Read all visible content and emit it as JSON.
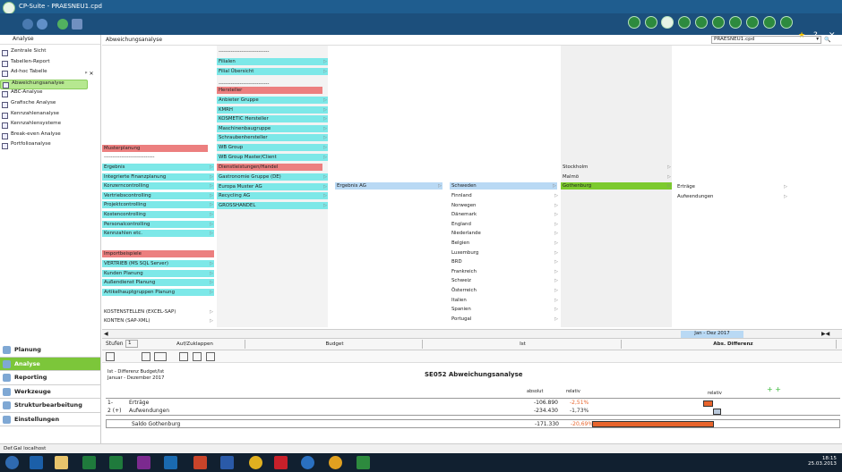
{
  "title": "CP-Suite - PRAESNEU1.cpd",
  "side": {
    "header": "Analyse",
    "items": [
      "Zentrale Sicht",
      "Tabellen-Report",
      "Ad-hoc Tabelle",
      "Abweichungsanalyse",
      "ABC-Analyse",
      "Grafische Analyse",
      "Kennzahlenanalyse",
      "Kennzahlensysteme",
      "Break-even Analyse",
      "Portfolioanalyse"
    ],
    "selected": 3
  },
  "main": {
    "header": "Abweichungsanalyse",
    "file": "PRAESNEU1.cpd"
  },
  "col1": {
    "group1_title": "Musterplanung",
    "group1_sep": "-----------------------------",
    "group1": [
      "Ergebnis",
      "Integrierte Finanzplanung",
      "Konzerncontrolling",
      "Vertriebscontrolling",
      "Projektcontrolling",
      "Kostencontrolling",
      "Personalcontrolling",
      "Kennzahlen etc."
    ],
    "group2_title": "Importbeispiele",
    "group2": [
      "VERTRIEB (MS SQL Server)",
      "Kunden Planung",
      "Außendienst Planung",
      "Artikelhauptgruppen Planung"
    ],
    "extra": [
      "KOSTENSTELLEN (EXCEL-SAP)",
      "KONTEN (SAP-XML)"
    ]
  },
  "col2": {
    "sep1": "-----------------------------",
    "top": [
      "Filialen",
      "Filial Übersicht"
    ],
    "sep2": "-----------------------------",
    "h_title": "Hersteller",
    "h_items": [
      "Anbieter Gruppe",
      "KMRH",
      "KOSMETIC Hersteller",
      "Maschinenbaugruppe",
      "Schraubenhersteller",
      "WB Group",
      "WB Group Master/Client"
    ],
    "d_title": "Dienstleistungen/Handel",
    "d_items": [
      "Gastronomie Gruppe (DE)",
      "Europa Muster AG",
      "Recycling AG",
      "GROSSHANDEL"
    ]
  },
  "col3": {
    "node": "Ergebnis AG"
  },
  "col4": {
    "selected": "Schweden",
    "items": [
      "Finnland",
      "Norwegen",
      "Dänemark",
      "England",
      "Niederlande",
      "Belgien",
      "Luxemburg",
      "BRD",
      "Frankreich",
      "Schweiz",
      "Österreich",
      "Italien",
      "Spanien",
      "Portugal"
    ]
  },
  "col5": {
    "items": [
      "Stockholm",
      "Malmö",
      "Gothenburg"
    ],
    "selected": 2
  },
  "col6": {
    "items": [
      "Erträge",
      "Aufwendungen"
    ]
  },
  "period": "Jan - Dez 2017",
  "filter": {
    "label": "Stufen",
    "value": "1",
    "c1": "Auf/Zuklappen",
    "c2": "Budget",
    "c3": "Ist",
    "c4": "Abs. Differenz"
  },
  "nav": [
    "Planung",
    "Analyse",
    "Reporting",
    "Werkzeuge",
    "Strukturbearbeitung",
    "Einstellungen"
  ],
  "report": {
    "sub1": "Ist - Differenz Budget/Ist",
    "sub2": "Januar - Dezember 2017",
    "title": "SE052 Abweichungsanalyse",
    "col_abs": "absolut",
    "col_rel": "relativ",
    "col_rel2": "relativ",
    "rows": [
      {
        "mark": "1-",
        "label": "Erträge",
        "abs": "-106.890",
        "rel": "-2,51%"
      },
      {
        "mark": "2 (+)",
        "label": "Aufwendungen",
        "abs": "-234.430",
        "rel": "-1,73%"
      }
    ],
    "total": {
      "label": "Saldo Gothenburg",
      "abs": "-171.330",
      "rel": "-20,69%"
    }
  },
  "status": "Def.Gal localhost",
  "clock": {
    "time": "18:15",
    "date": "25.03.2013"
  },
  "colors": {
    "cyan": "#7de8e8",
    "red": "#ec7f7f",
    "blue": "#b9d9f4",
    "green": "#7cca2e",
    "bar": "#e8642c"
  }
}
